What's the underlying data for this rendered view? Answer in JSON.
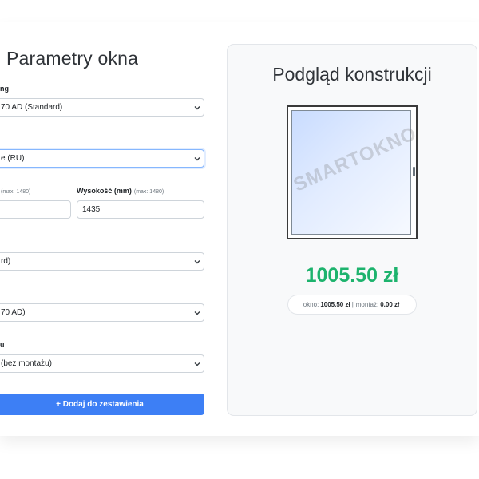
{
  "panel": {
    "title": "Parametry okna"
  },
  "fields": {
    "profile": {
      "label": "ng",
      "value": "70 AD (Standard)"
    },
    "opening": {
      "value": "e (RU)"
    },
    "width": {
      "label_small": "(max: 1480)",
      "value": ""
    },
    "height": {
      "label": "Wysokość (mm)",
      "label_small": "(max: 1480)",
      "value": "1435"
    },
    "glass": {
      "value": "rd)"
    },
    "sill": {
      "value": "70 AD)"
    },
    "mounting": {
      "label": "u",
      "value": "(bez montażu)"
    }
  },
  "actions": {
    "add_label": "+ Dodaj do zestawienia"
  },
  "preview": {
    "title": "Podgląd konstrukcji",
    "watermark": "SMARTOKNO",
    "price": "1005.50 zł",
    "breakdown": {
      "window_label": "okno:",
      "window_value": "1005.50 zł",
      "separator": "|",
      "mount_label": "montaż:",
      "mount_value": "0.00 zł"
    }
  },
  "colors": {
    "accent": "#3d7ff5",
    "price": "#1db36d",
    "glass": "#c9dcff"
  }
}
